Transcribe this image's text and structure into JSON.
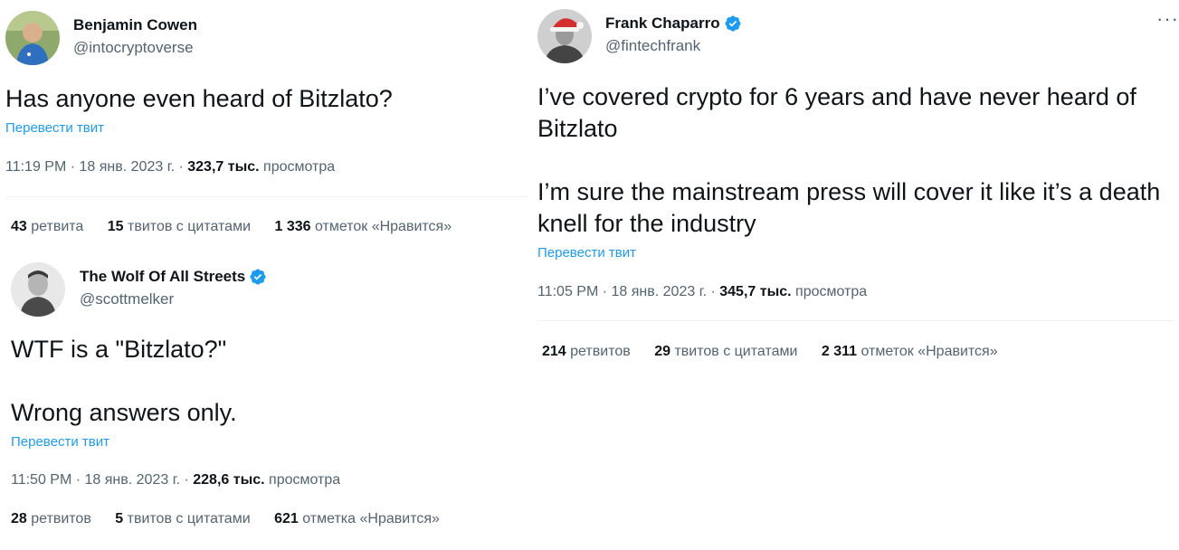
{
  "tweets": [
    {
      "name": "Benjamin Cowen",
      "handle": "@intocryptoverse",
      "verified": false,
      "text": "Has anyone even heard of Bitzlato?",
      "translate": "Перевести твит",
      "time": "11:19 PM · 18 янв. 2023 г. ·",
      "views_count": "323,7 тыс.",
      "views_label": "просмотра",
      "retweets_count": "43",
      "retweets_label": "ретвита",
      "quotes_count": "15",
      "quotes_label": "твитов с цитатами",
      "likes_count": "1 336",
      "likes_label": "отметок «Нравится»"
    },
    {
      "name": "The Wolf Of All Streets",
      "handle": "@scottmelker",
      "verified": true,
      "text": "WTF is a \"Bitzlato?\"\n\nWrong answers only.",
      "translate": "Перевести твит",
      "time": "11:50 PM · 18 янв. 2023 г. ·",
      "views_count": "228,6 тыс.",
      "views_label": "просмотра",
      "retweets_count": "28",
      "retweets_label": "ретвитов",
      "quotes_count": "5",
      "quotes_label": "твитов с цитатами",
      "likes_count": "621",
      "likes_label": "отметка «Нравится»"
    },
    {
      "name": "Frank Chaparro",
      "handle": "@fintechfrank",
      "verified": true,
      "text": "I’ve covered crypto for 6 years and have never heard of Bitzlato\n\nI’m sure the mainstream press will cover it like it’s a death knell for the industry",
      "translate": "Перевести твит",
      "time": "11:05 PM · 18 янв. 2023 г. ·",
      "views_count": "345,7 тыс.",
      "views_label": "просмотра",
      "retweets_count": "214",
      "retweets_label": "ретвитов",
      "quotes_count": "29",
      "quotes_label": "твитов с цитатами",
      "likes_count": "2 311",
      "likes_label": "отметок «Нравится»"
    }
  ],
  "more_icon": "more-horizontal-icon",
  "more_glyph": "···",
  "colors": {
    "link": "#1d9bf0",
    "secondary": "#536471",
    "primary": "#0f1419",
    "verified": "#1d9bf0"
  }
}
